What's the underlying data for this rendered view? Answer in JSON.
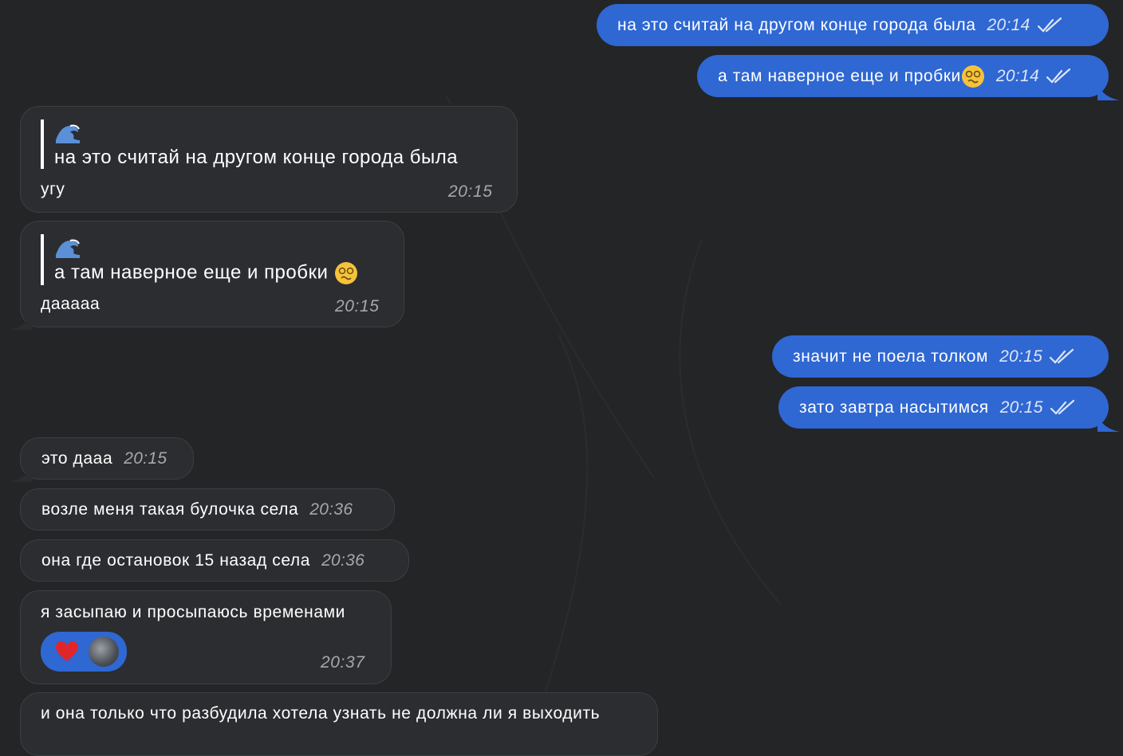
{
  "colors": {
    "background": "#232527",
    "outgoing": "#2f67d3",
    "incoming": "#2b2d30"
  },
  "messages": [
    {
      "side": "outgoing",
      "text": "на это считай на другом конце города была",
      "time": "20:14",
      "status": "read"
    },
    {
      "side": "outgoing",
      "text": "а там наверное еще и пробки",
      "emoji": "woozy-face",
      "time": "20:14",
      "status": "read"
    },
    {
      "side": "incoming",
      "quote_emoji": "wave",
      "quote_text": "на это считай на другом конце города была",
      "text": "угу",
      "time": "20:15"
    },
    {
      "side": "incoming",
      "quote_emoji": "wave",
      "quote_text": "а там наверное еще и пробки",
      "quote_trailing_emoji": "woozy-face",
      "text": "дааааа",
      "time": "20:15"
    },
    {
      "side": "outgoing",
      "text": "значит не поела толком",
      "time": "20:15",
      "status": "read"
    },
    {
      "side": "outgoing",
      "text": "зато завтра насытимся",
      "time": "20:15",
      "status": "read"
    },
    {
      "side": "incoming",
      "text": "это дааа",
      "time": "20:15"
    },
    {
      "side": "incoming",
      "text": "возле меня такая булочка села",
      "time": "20:36"
    },
    {
      "side": "incoming",
      "text": "она где остановок 15 назад села",
      "time": "20:36"
    },
    {
      "side": "incoming",
      "text": "я засыпаю и просыпаюсь временами",
      "time": "20:37",
      "reaction": {
        "emoji": "red-heart",
        "by": "avatar"
      }
    },
    {
      "side": "incoming",
      "text": "и она только что разбудила хотела узнать не должна ли я выходить"
    }
  ]
}
